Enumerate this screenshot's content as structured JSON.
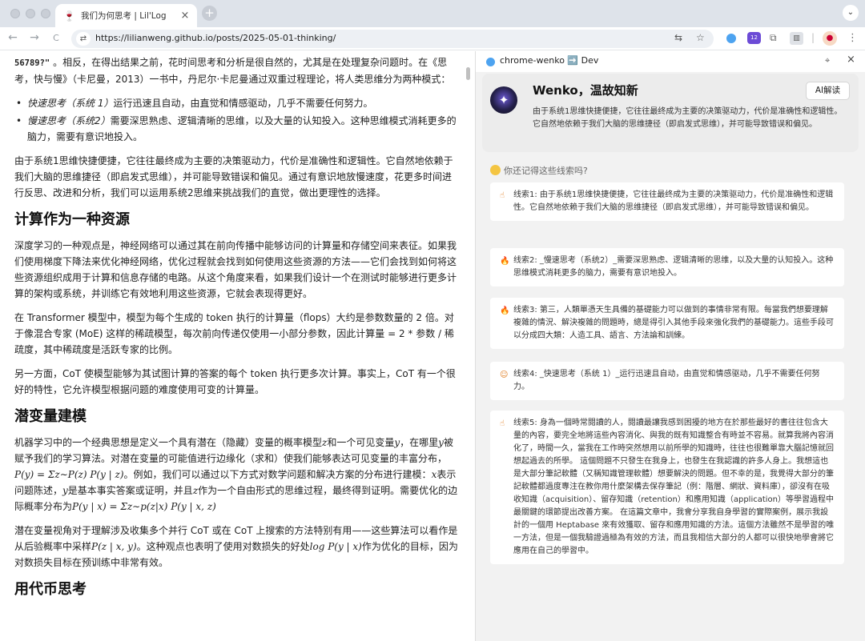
{
  "browser": {
    "tab": {
      "title": "我们为何思考 | Lil'Log",
      "favicon": "🍷",
      "close": "×"
    },
    "new_tab": "+",
    "tab_menu": "⌄",
    "nav": {
      "back": "←",
      "forward": "→",
      "reload": "C"
    },
    "url": "https://lilianweng.github.io/posts/2025-05-01-thinking/",
    "ext_badge": "12"
  },
  "article": {
    "intro_code": "56789?\"",
    "intro_rest": " 。相反，在得出结果之前，花时间思考和分析是很自然的，尤其是在处理复杂问题时。在《思考，快与慢》（卡尼曼，2013）一书中，丹尼尔·卡尼曼通过双重过程理论，将人类思维分为两种模式：",
    "bullets": [
      {
        "term": "快速思考（系统 1）",
        "text": "运行迅速且自动，由直觉和情感驱动，几乎不需要任何努力。"
      },
      {
        "term": "慢速思考（系统2）",
        "text": "需要深思熟虑、逻辑清晰的思维，以及大量的认知投入。这种思维模式消耗更多的脑力，需要有意识地投入。"
      }
    ],
    "para_system1": "由于系统1思维快捷便捷，它往往最终成为主要的决策驱动力，代价是准确性和逻辑性。它自然地依赖于我们大脑的思维捷径（即启发式思维），并可能导致错误和偏见。通过有意识地放慢速度，花更多时间进行反思、改进和分析，我们可以运用系统2思维来挑战我们的直觉，做出更理性的选择。",
    "h_compute": "计算作为一种资源",
    "para_compute_1": "深度学习的一种观点是，神经网络可以通过其在前向传播中能够访问的计算量和存储空间来表征。如果我们使用梯度下降法来优化神经网络，优化过程就会找到如何使用这些资源的方法——它们会找到如何将这些资源组织成用于计算和信息存储的电路。从这个角度来看，如果我们设计一个在测试时能够进行更多计算的架构或系统，并训练它有效地利用这些资源，它就会表现得更好。",
    "para_compute_2": "在 Transformer 模型中，模型为每个生成的 token 执行的计算量（flops）大约是参数数量的 2 倍。对于像混合专家 (MoE) 这样的稀疏模型，每次前向传递仅使用一小部分参数，因此计算量 = 2 * 参数 / 稀疏度，其中稀疏度是活跃专家的比例。",
    "para_compute_3": "另一方面，CoT 使模型能够为其试图计算的答案的每个 token 执行更多次计算。事实上，CoT 有一个很好的特性，它允许模型根据问题的难度使用可变的计算量。",
    "h_latent": "潜变量建模",
    "para_latent_a": "机器学习中的一个经典思想是定义一个具有潜在（隐藏）变量的概率模型",
    "para_latent_b": "和一个可见变量",
    "para_latent_c": "，在哪里",
    "para_latent_d": "被赋予我们的学习算法。对潜在变量的可能值进行边缘化（求和）使我们能够表达可见变量的丰富分布，",
    "math_py": "P(y) = Σz∼P(z) P(y | z)",
    "para_latent_e": "。例如，我们可以通过以下方式对数学问题和解决方案的分布进行建模：",
    "para_latent_f": "表示问题陈述，",
    "para_latent_g": "是基本事实答案或证明，并且",
    "para_latent_h": "作为一个自由形式的思维过程，最终得到证明。需要优化的边际概率分布为",
    "math_pyx": "P(y | x) = Σz∼p(z|x) P(y | x, z)",
    "var_z": "z",
    "var_y": "y",
    "var_x": "x",
    "para_latent2_a": "潜在变量视角对于理解涉及收集多个并行 CoT 或在 CoT 上搜索的方法特别有用——这些算法可以看作是从后验概率中采样",
    "math_post": "P(z | x, y)",
    "para_latent2_b": "。这种观点也表明了使用对数损失的好处",
    "math_log": "log P(y | x)",
    "para_latent2_c": "作为优化的目标，因为对数损失目标在预训练中非常有效。",
    "h_tokens": "用代币思考"
  },
  "panel": {
    "header_title": "chrome-wenko ➡️ Dev",
    "pin": "⌖",
    "close": "×",
    "hero_title": "Wenko，温故知新",
    "ai_button": "AI解读",
    "hero_text": "由于系统1思维快捷便捷，它往往最终成为主要的决策驱动力，代价是准确性和逻辑性。它自然地依赖于我们大脑的思维捷径（即启发式思维），并可能导致错误和偏见。",
    "recall": "你还记得这些线索吗?",
    "clues": [
      {
        "icon": "☝",
        "text": "线索1: 由于系统1思维快捷便捷，它往往最终成为主要的决策驱动力，代价是准确性和逻辑性。它自然地依赖于我们大脑的思维捷径（即启发式思维），并可能导致错误和偏见。"
      },
      {
        "icon": "🔥",
        "text": "线索2: _慢速思考（系统2）_需要深思熟虑、逻辑清晰的思维，以及大量的认知投入。这种思维模式消耗更多的脑力，需要有意识地投入。"
      },
      {
        "icon": "🔥",
        "text": "线索3: 第三，人類單憑天生具備的基礎能力可以做到的事情非常有限。每當我們想要理解複雜的情況、解決複雜的問題時，總是得引入其他手段來強化我們的基礎能力。這些手段可以分成四大類：人造工具、語言、方法論和訓練。"
      },
      {
        "icon": "☺",
        "text": "线索4: _快速思考（系统 1）_运行迅速且自动，由直觉和情感驱动，几乎不需要任何努力。"
      },
      {
        "icon": "☝",
        "text": "线索5: 身為一個時常閱讀的人，閱讀最讓我感到困擾的地方在於那些最好的書往往包含大量的內容，要完全地將這些內容消化、與我的既有知識整合有時並不容易。就算我將內容消化了，時間一久，當我在工作時突然想用以前所學的知識時，往往也很難單靠大腦記憶就回想起過去的所學。 這個問題不只發生在我身上，也發生在我認識的許多人身上。我想這也是大部分筆記軟體（又稱知識管理軟體）想要解決的問題。但不幸的是，我覺得大部分的筆記軟體都過度專注在教你用什麼架構去保存筆記（例：階層、網狀、資料庫），卻沒有在吸收知識（acquisition）、留存知識（retention）和應用知識（application）等學習過程中最關鍵的環節提出改善方案。 在這篇文章中，我會分享我自身學習的實際案例，展示我設計的一個用 Heptabase 來有效獲取、留存和應用知識的方法。這個方法雖然不是學習的唯一方法，但是一個我驗證過極為有效的方法，而且我相信大部分的人都可以很快地學會將它應用在自己的學習中。"
      }
    ]
  }
}
